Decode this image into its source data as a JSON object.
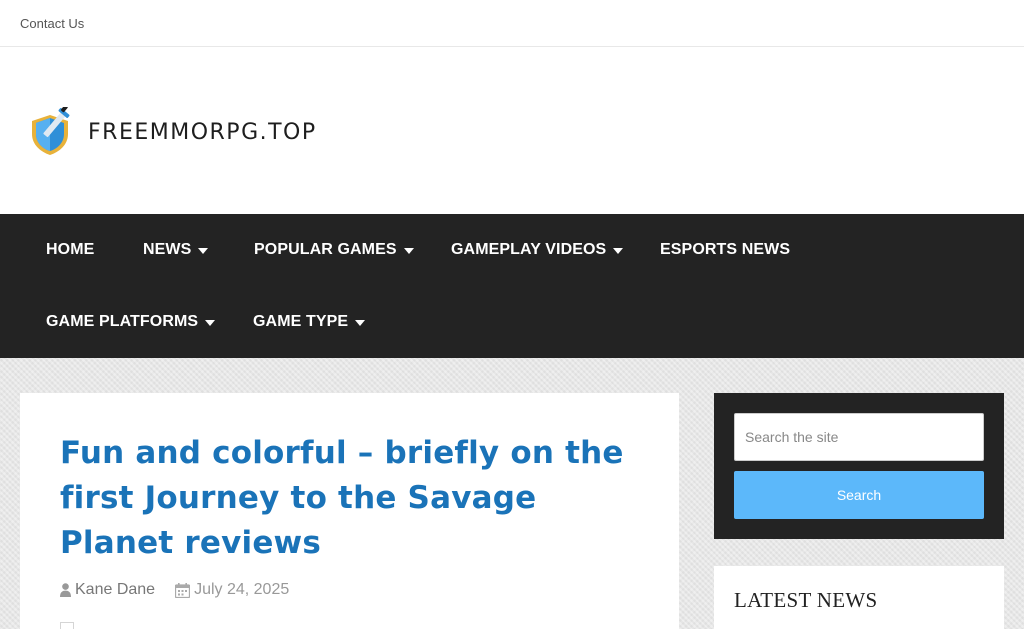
{
  "topbar": {
    "contact_label": "Contact Us"
  },
  "brand": {
    "logo_text": "FREEMMORPG.TOP"
  },
  "nav": {
    "items": [
      {
        "label": "HOME",
        "dropdown": false
      },
      {
        "label": "NEWS",
        "dropdown": true
      },
      {
        "label": "POPULAR GAMES",
        "dropdown": true
      },
      {
        "label": "GAMEPLAY VIDEOS",
        "dropdown": true
      },
      {
        "label": "ESPORTS NEWS",
        "dropdown": false
      },
      {
        "label": "GAME PLATFORMS",
        "dropdown": true
      },
      {
        "label": "GAME TYPE",
        "dropdown": true
      }
    ]
  },
  "article": {
    "title": "Fun and colorful – briefly on the first Journey to the Savage Planet reviews",
    "author": "Kane Dane",
    "date": "July 24, 2025",
    "author_icon": "user-icon",
    "date_icon": "calendar-icon"
  },
  "sidebar": {
    "search_placeholder": "Search the site",
    "search_button": "Search",
    "latest_heading": "LATEST NEWS"
  },
  "colors": {
    "nav_bg": "#232323",
    "title_blue": "#1a73b8",
    "search_button": "#5cb8fa"
  }
}
